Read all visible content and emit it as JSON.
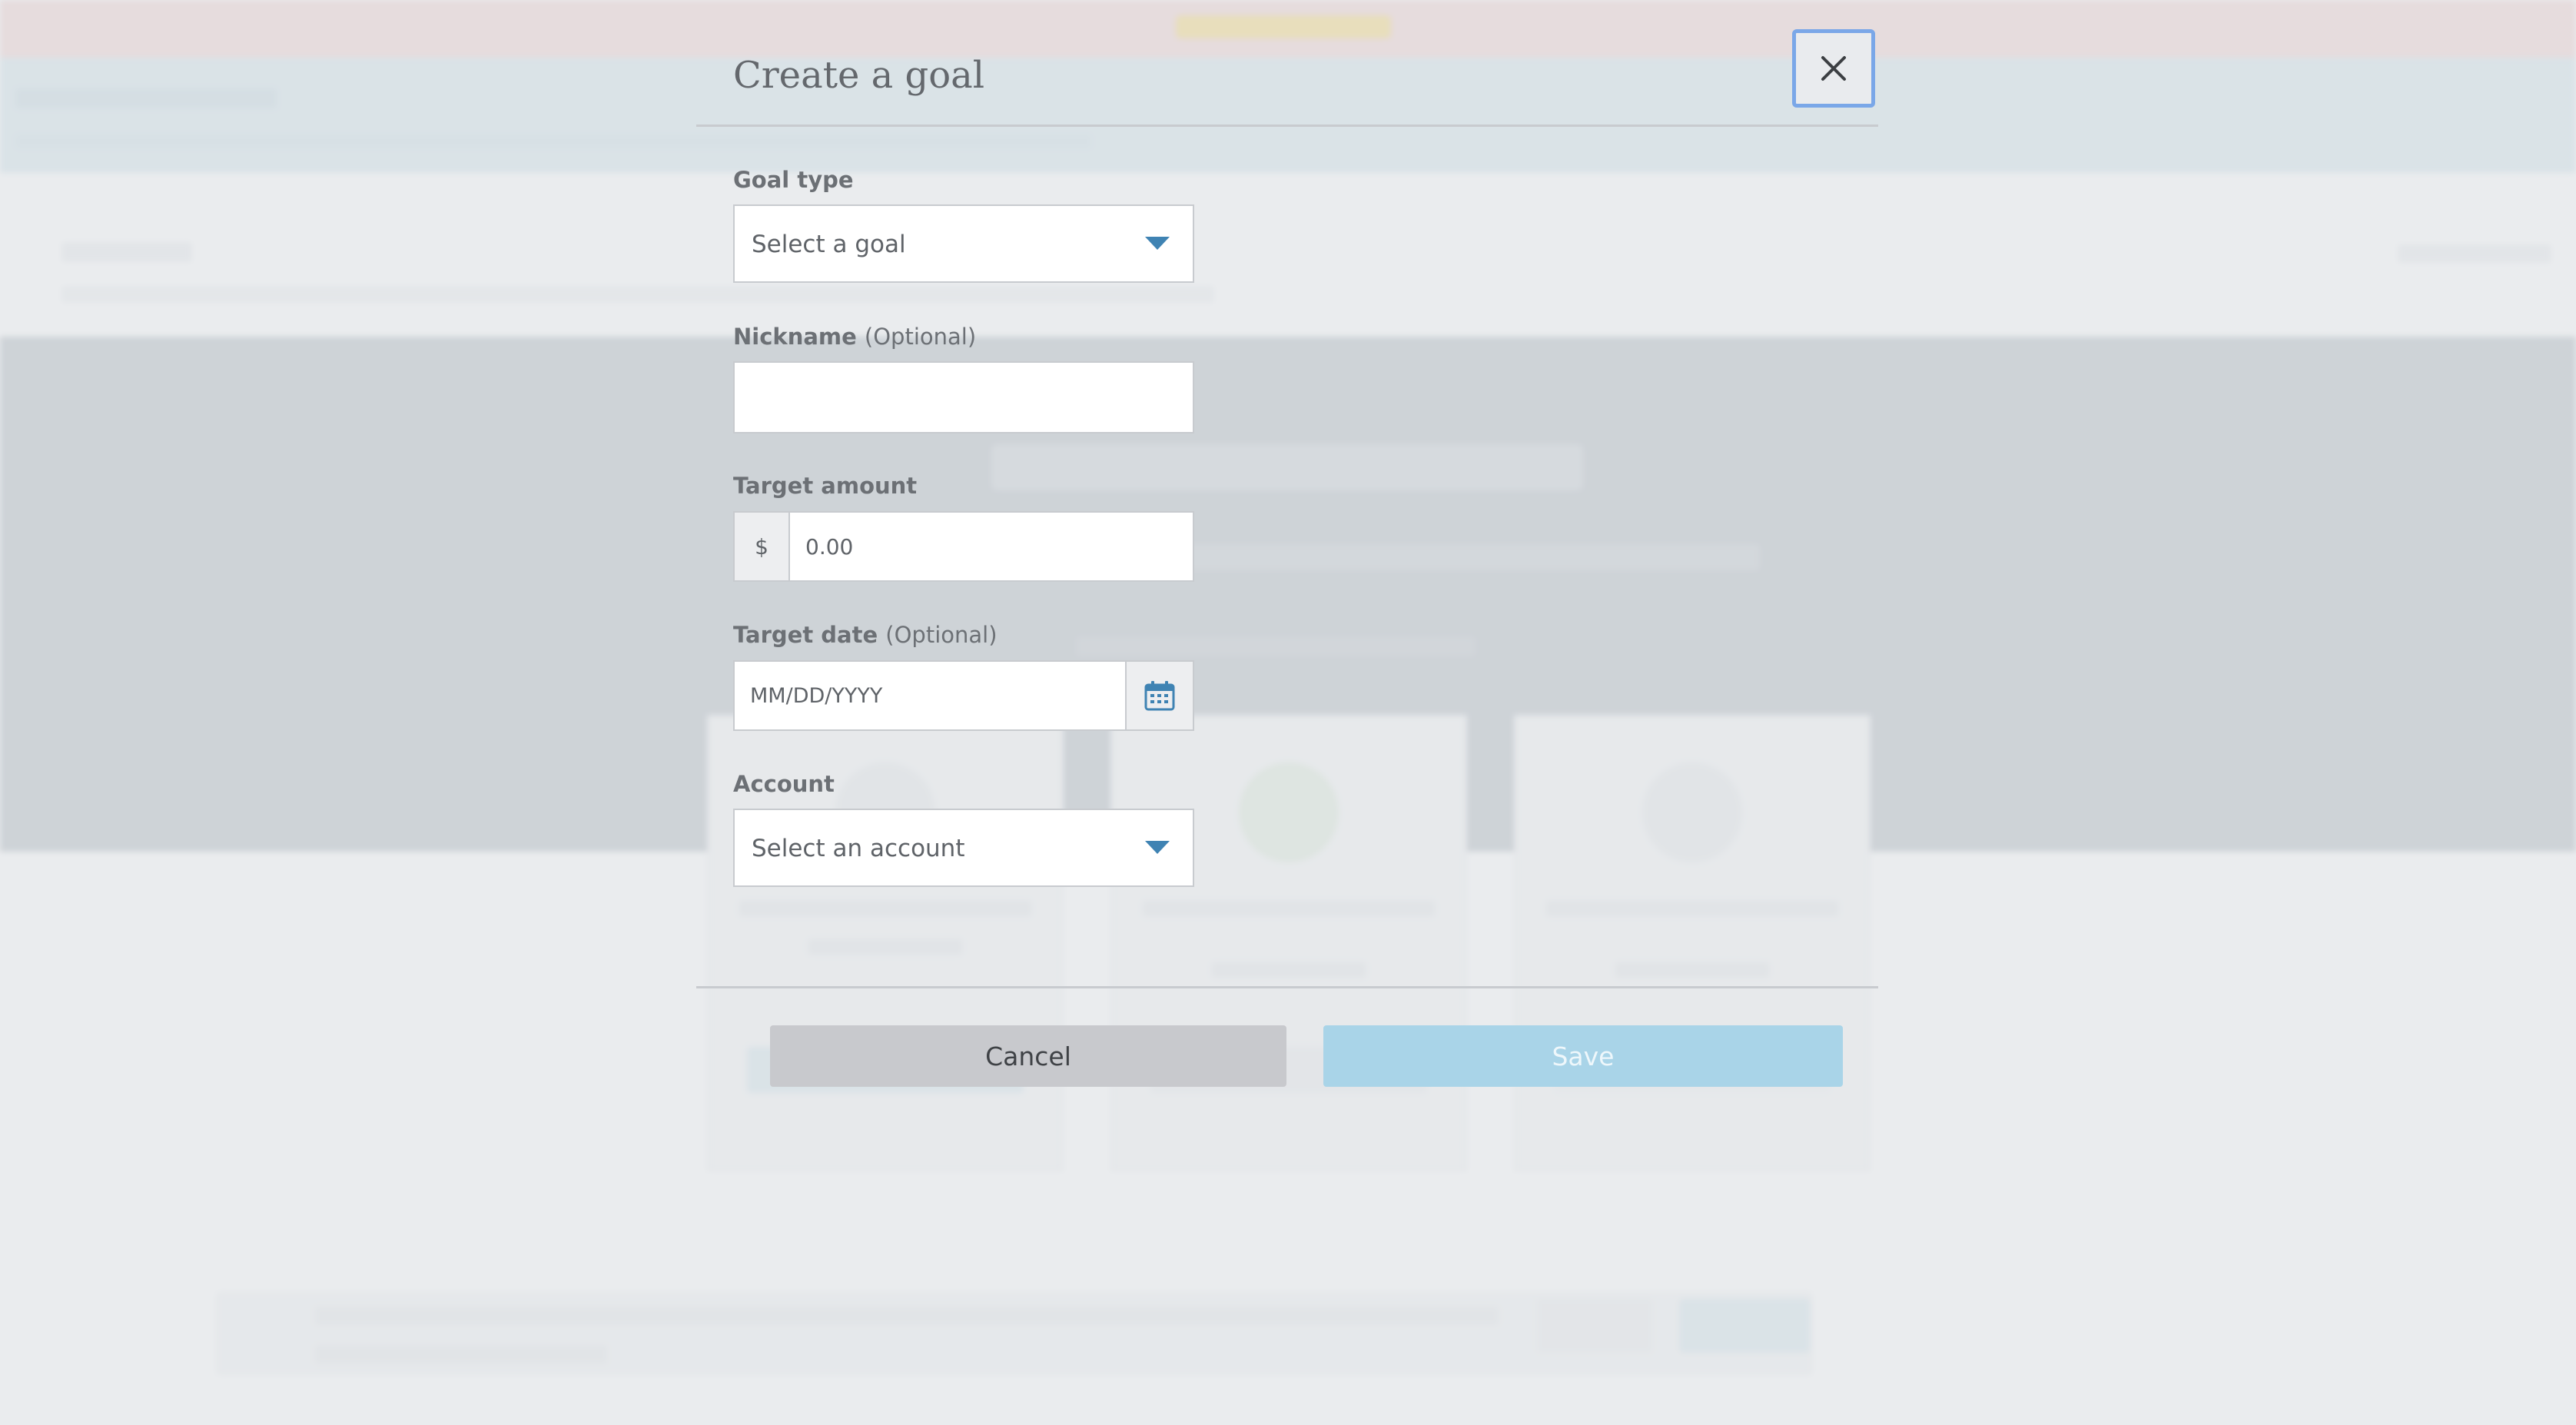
{
  "modal": {
    "title": "Create a goal",
    "close_label": "Close"
  },
  "fields": {
    "goal_type": {
      "label": "Goal type",
      "selected": "Select a goal"
    },
    "nickname": {
      "label": "Nickname",
      "optional": "(Optional)",
      "value": ""
    },
    "target_amount": {
      "label": "Target amount",
      "prefix": "$",
      "placeholder": "0.00"
    },
    "target_date": {
      "label": "Target date",
      "optional": "(Optional)",
      "placeholder": "MM/DD/YYYY"
    },
    "account": {
      "label": "Account",
      "selected": "Select an account"
    }
  },
  "actions": {
    "cancel_label": "Cancel",
    "save_label": "Save"
  },
  "icons": {
    "close": "close-icon",
    "dropdown": "chevron-down-icon",
    "calendar": "calendar-icon"
  },
  "colors": {
    "accent": "#3f83b3",
    "save_button": "#a9d4e8",
    "cancel_button": "#c8c9cd",
    "focus_ring": "#7aa7e8"
  }
}
